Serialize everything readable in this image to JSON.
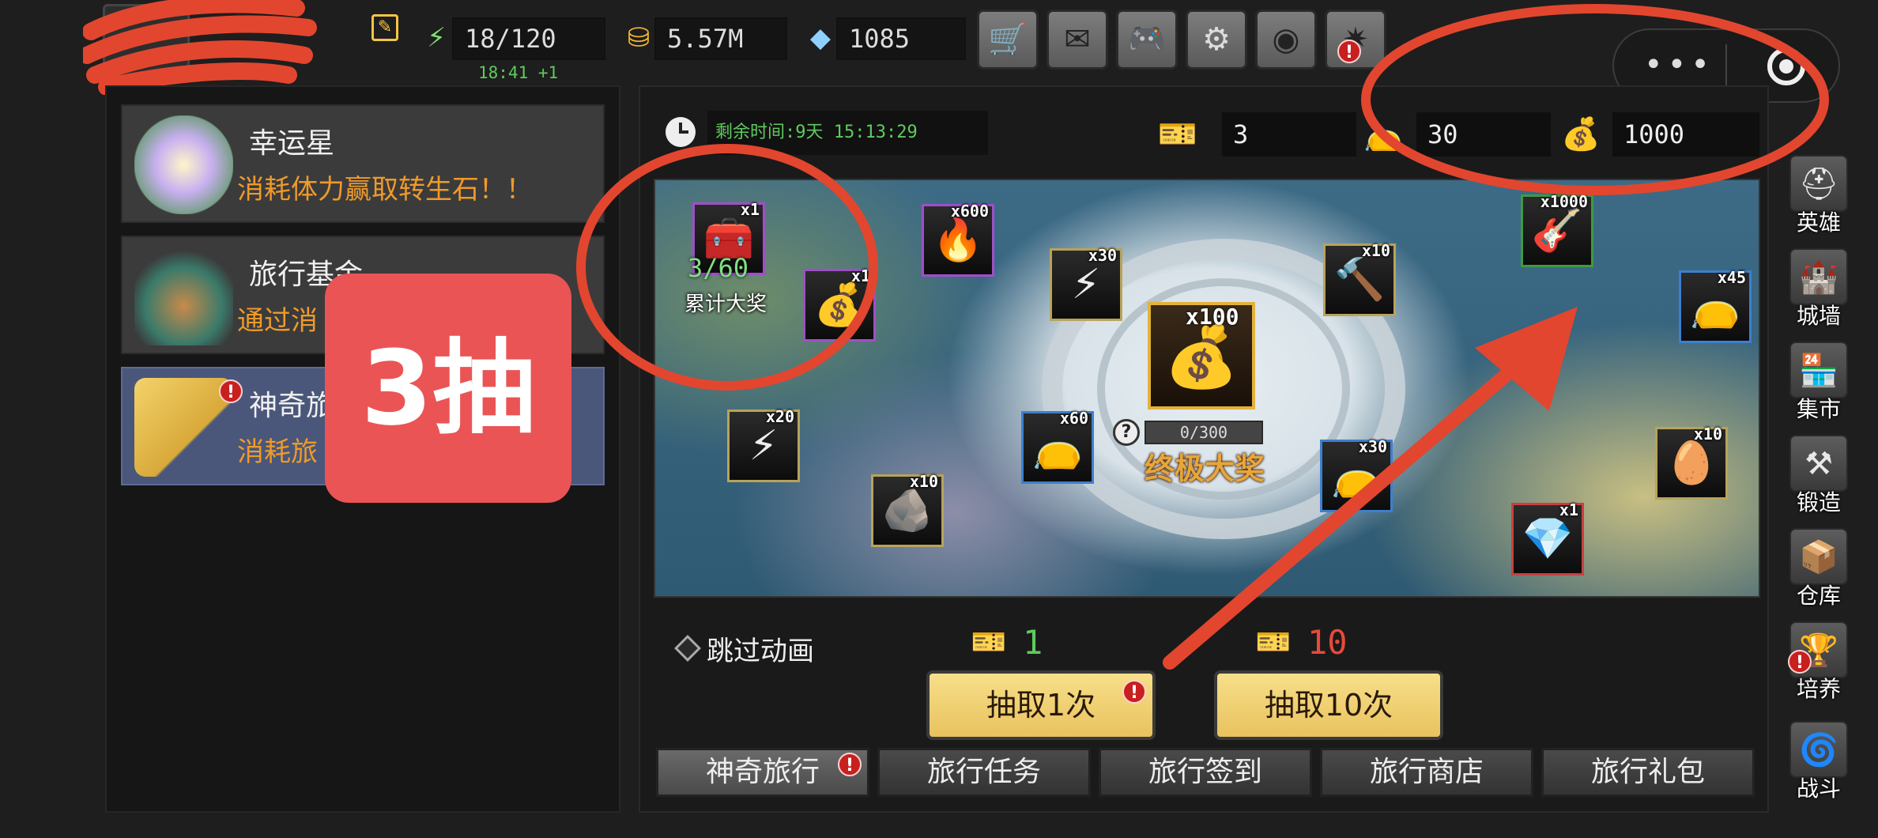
{
  "header": {
    "stamina": "18/120",
    "stamina_timer": "18:41 +1",
    "gold": "5.57M",
    "gems": "1085",
    "toolbar_icons": [
      "shop-cart-icon",
      "mail-icon",
      "gamepad-icon",
      "gear-icon",
      "aperture-icon",
      "firework-icon"
    ]
  },
  "sidebar": {
    "activities": [
      {
        "title": "幸运星",
        "desc": "消耗体力赢取转生石！！",
        "icon": "lucky-star-icon"
      },
      {
        "title": "旅行基金",
        "desc": "通过消",
        "icon": "travel-fund-bag-icon"
      },
      {
        "title": "神奇旅",
        "desc": "消耗旅",
        "icon": "travel-ticket-icon"
      }
    ]
  },
  "overlay": {
    "badge_text": "3抽"
  },
  "event": {
    "remaining_time": "剩余时间:9天 15:13:29",
    "tickets": "3",
    "small_bags": "30",
    "big_bags": "1000"
  },
  "board": {
    "cumulative_count": "3/60",
    "cumulative_label": "累计大奖",
    "grand_qty": "x100",
    "grand_progress_text": "0/300",
    "grand_progress": 0,
    "grand_label": "终极大奖",
    "items": [
      {
        "qty": "x1",
        "icon": "treasure-icon"
      },
      {
        "qty": "x1",
        "icon": "red-bag-icon"
      },
      {
        "qty": "x600",
        "icon": "fire-orb-icon"
      },
      {
        "qty": "x30",
        "icon": "lightning-shard-icon"
      },
      {
        "qty": "x10",
        "icon": "hammer-icon"
      },
      {
        "qty": "x1000",
        "icon": "guitar-icon"
      },
      {
        "qty": "x45",
        "icon": "pink-bag-icon"
      },
      {
        "qty": "x20",
        "icon": "lightning-icon"
      },
      {
        "qty": "x60",
        "icon": "pink-bag-icon"
      },
      {
        "qty": "x30",
        "icon": "pink-bag-icon"
      },
      {
        "qty": "x10",
        "icon": "blue-stone-icon"
      },
      {
        "qty": "x10",
        "icon": "golden-egg-icon"
      },
      {
        "qty": "x1",
        "icon": "crystal-icon"
      }
    ]
  },
  "controls": {
    "skip_animation": "跳过动画",
    "draw1_cost": "1",
    "draw10_cost": "10",
    "draw1_label": "抽取1次",
    "draw10_label": "抽取10次"
  },
  "tabs": [
    "神奇旅行",
    "旅行任务",
    "旅行签到",
    "旅行商店",
    "旅行礼包"
  ],
  "side_nav": [
    "英雄",
    "城墙",
    "集市",
    "锻造",
    "仓库",
    "培养",
    "战斗"
  ],
  "colors": {
    "accent_orange": "#ef9a2a",
    "timer_green": "#5ecb5e",
    "annotation_red": "#e2462f",
    "badge_red": "#ea5455",
    "button_gold": "#f0d278"
  }
}
